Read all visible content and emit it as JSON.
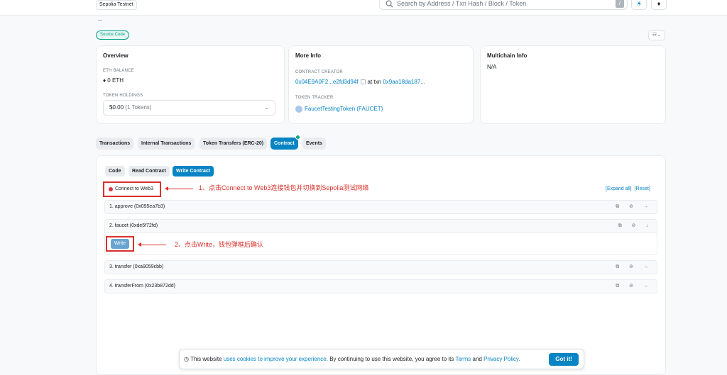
{
  "header": {
    "network": "Sepolia Testnet",
    "search_placeholder": "Search by Address / Txn Hash / Block / Token",
    "slash_key": "/",
    "theme_icon": "☀",
    "eth_icon": "♦"
  },
  "source_code_badge": "Source Code",
  "view_toggle": "☷⌄",
  "overview": {
    "title": "Overview",
    "eth_balance_label": "ETH BALANCE",
    "eth_balance_value": "♦ 0 ETH",
    "token_holdings_label": "TOKEN HOLDINGS",
    "token_holdings_value": "$0.00",
    "token_holdings_count": "(1 Tokens)"
  },
  "more_info": {
    "title": "More Info",
    "creator_label": "CONTRACT CREATOR",
    "creator_address": "0x04E9A0F2...e2fd3d94f",
    "at_txn": "at txn",
    "txn_hash": "0x9aa18da187...",
    "tracker_label": "TOKEN TRACKER",
    "tracker_value": "FaucetTestingToken (FAUCET)"
  },
  "multichain": {
    "title": "Multichain Info",
    "value": "N/A"
  },
  "tabs": [
    "Transactions",
    "Internal Transactions",
    "Token Transfers (ERC-20)",
    "Contract",
    "Events"
  ],
  "contract_subtabs": [
    "Code",
    "Read Contract",
    "Write Contract"
  ],
  "connect_button": "Connect to Web3",
  "expand_all": "[Expand all]",
  "reset": "[Reset]",
  "functions": [
    {
      "label": "1. approve (0x095ea7b3)",
      "arrow": "→"
    },
    {
      "label": "2. faucet (0xde5f72fd)",
      "arrow": "↓"
    },
    {
      "label": "3. transfer (0xa9059cbb)",
      "arrow": "→"
    },
    {
      "label": "4. transferFrom (0x23b872dd)",
      "arrow": "→"
    }
  ],
  "fn_icons": "⧉ ⊘",
  "write_button": "Write",
  "annotations": {
    "step1": "1、点击Connect to Web3连接钱包并切换到Sepolia测试网络",
    "step2": "2、点击Write，钱包弹框后确认"
  },
  "cookie": {
    "icon": "◷",
    "prefix": "This website",
    "link1": "uses cookies to improve your experience.",
    "middle": "By continuing to use this website, you agree to its",
    "terms": "Terms",
    "and": "and",
    "privacy": "Privacy Policy.",
    "button": "Got it!"
  },
  "colors": {
    "primary": "#0784c3",
    "annotation_red": "#d9302b",
    "success_green": "#00a186"
  }
}
